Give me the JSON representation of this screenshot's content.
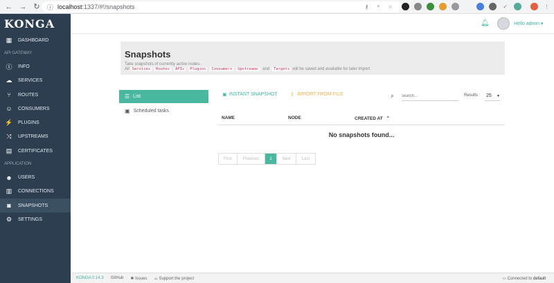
{
  "browser": {
    "url_host": "localhost",
    "url_rest": ":1337/#!/snapshots"
  },
  "sidebar": {
    "logo": "KONGA",
    "items_top": [
      {
        "label": "DASHBOARD",
        "icon": "grid-icon"
      }
    ],
    "section_gateway": "API GATEWAY",
    "items_gateway": [
      {
        "label": "INFO",
        "icon": "info-icon"
      },
      {
        "label": "SERVICES",
        "icon": "cloud-icon"
      },
      {
        "label": "ROUTES",
        "icon": "routes-icon"
      },
      {
        "label": "CONSUMERS",
        "icon": "user-icon"
      },
      {
        "label": "PLUGINS",
        "icon": "plug-icon"
      },
      {
        "label": "UPSTREAMS",
        "icon": "shuffle-icon"
      },
      {
        "label": "CERTIFICATES",
        "icon": "certificate-icon"
      }
    ],
    "section_application": "APPLICATION",
    "items_application": [
      {
        "label": "USERS",
        "icon": "users-icon"
      },
      {
        "label": "CONNECTIONS",
        "icon": "connections-icon"
      },
      {
        "label": "SNAPSHOTS",
        "icon": "camera-icon"
      },
      {
        "label": "SETTINGS",
        "icon": "gear-icon"
      }
    ]
  },
  "topbar": {
    "greeting": "Hello  admin ▾"
  },
  "page": {
    "title": "Snapshots",
    "description": "Take snapshots of currently active nodes.",
    "desc_prefix": "All",
    "tags": [
      "Services",
      "Routes",
      "APIs",
      "Plugins",
      "Consumers",
      "Upstreams"
    ],
    "tag_last": "Targets",
    "desc_and": "and",
    "desc_suffix": "will be saved and available for later import."
  },
  "left_menu": {
    "list_label": "List",
    "scheduled_label": "Scheduled tasks"
  },
  "actions": {
    "instant_label": "INSTANT SNAPSHOT",
    "import_label": "IMPORT FROM FILE",
    "search_placeholder": "search...",
    "results_label": "Results :",
    "results_value": "25"
  },
  "table": {
    "columns": [
      "NAME",
      "NODE",
      "CREATED AT"
    ],
    "empty_text": "No snapshots found..."
  },
  "pager": {
    "first": "First",
    "previous": "Previous",
    "page": "1",
    "next": "Next",
    "last": "Last"
  },
  "footer": {
    "version": "KONGA 0.14.3",
    "github": "GitHub",
    "issues": "Issues",
    "support": "Support the project",
    "connected_prefix": "Connected to",
    "connected_name": "default"
  },
  "colors": {
    "sidebar_bg": "#2c3e50",
    "accent": "#4ab89f",
    "import_color": "#f0ad4e"
  }
}
